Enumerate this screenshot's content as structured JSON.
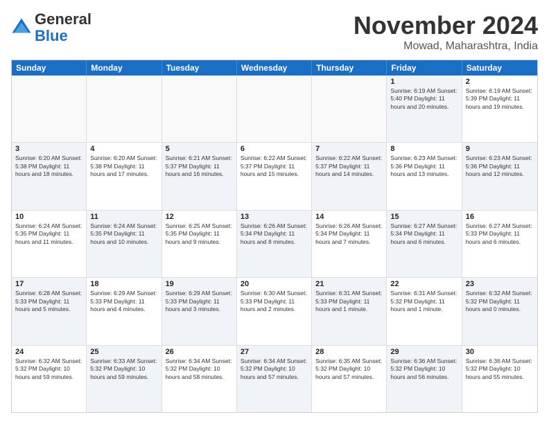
{
  "logo": {
    "line1": "General",
    "line2": "Blue"
  },
  "title": "November 2024",
  "location": "Mowad, Maharashtra, India",
  "headers": [
    "Sunday",
    "Monday",
    "Tuesday",
    "Wednesday",
    "Thursday",
    "Friday",
    "Saturday"
  ],
  "rows": [
    [
      {
        "day": "",
        "info": "",
        "empty": true
      },
      {
        "day": "",
        "info": "",
        "empty": true
      },
      {
        "day": "",
        "info": "",
        "empty": true
      },
      {
        "day": "",
        "info": "",
        "empty": true
      },
      {
        "day": "",
        "info": "",
        "empty": true
      },
      {
        "day": "1",
        "info": "Sunrise: 6:19 AM\nSunset: 5:40 PM\nDaylight: 11 hours and 20 minutes.",
        "shaded": true
      },
      {
        "day": "2",
        "info": "Sunrise: 6:19 AM\nSunset: 5:39 PM\nDaylight: 11 hours and 19 minutes.",
        "shaded": false
      }
    ],
    [
      {
        "day": "3",
        "info": "Sunrise: 6:20 AM\nSunset: 5:38 PM\nDaylight: 11 hours and 18 minutes.",
        "shaded": true
      },
      {
        "day": "4",
        "info": "Sunrise: 6:20 AM\nSunset: 5:38 PM\nDaylight: 11 hours and 17 minutes.",
        "shaded": false
      },
      {
        "day": "5",
        "info": "Sunrise: 6:21 AM\nSunset: 5:37 PM\nDaylight: 11 hours and 16 minutes.",
        "shaded": true
      },
      {
        "day": "6",
        "info": "Sunrise: 6:22 AM\nSunset: 5:37 PM\nDaylight: 11 hours and 15 minutes.",
        "shaded": false
      },
      {
        "day": "7",
        "info": "Sunrise: 6:22 AM\nSunset: 5:37 PM\nDaylight: 11 hours and 14 minutes.",
        "shaded": true
      },
      {
        "day": "8",
        "info": "Sunrise: 6:23 AM\nSunset: 5:36 PM\nDaylight: 11 hours and 13 minutes.",
        "shaded": false
      },
      {
        "day": "9",
        "info": "Sunrise: 6:23 AM\nSunset: 5:36 PM\nDaylight: 11 hours and 12 minutes.",
        "shaded": true
      }
    ],
    [
      {
        "day": "10",
        "info": "Sunrise: 6:24 AM\nSunset: 5:35 PM\nDaylight: 11 hours and 11 minutes.",
        "shaded": false
      },
      {
        "day": "11",
        "info": "Sunrise: 6:24 AM\nSunset: 5:35 PM\nDaylight: 11 hours and 10 minutes.",
        "shaded": true
      },
      {
        "day": "12",
        "info": "Sunrise: 6:25 AM\nSunset: 5:35 PM\nDaylight: 11 hours and 9 minutes.",
        "shaded": false
      },
      {
        "day": "13",
        "info": "Sunrise: 6:26 AM\nSunset: 5:34 PM\nDaylight: 11 hours and 8 minutes.",
        "shaded": true
      },
      {
        "day": "14",
        "info": "Sunrise: 6:26 AM\nSunset: 5:34 PM\nDaylight: 11 hours and 7 minutes.",
        "shaded": false
      },
      {
        "day": "15",
        "info": "Sunrise: 6:27 AM\nSunset: 5:34 PM\nDaylight: 11 hours and 6 minutes.",
        "shaded": true
      },
      {
        "day": "16",
        "info": "Sunrise: 6:27 AM\nSunset: 5:33 PM\nDaylight: 11 hours and 6 minutes.",
        "shaded": false
      }
    ],
    [
      {
        "day": "17",
        "info": "Sunrise: 6:28 AM\nSunset: 5:33 PM\nDaylight: 11 hours and 5 minutes.",
        "shaded": true
      },
      {
        "day": "18",
        "info": "Sunrise: 6:29 AM\nSunset: 5:33 PM\nDaylight: 11 hours and 4 minutes.",
        "shaded": false
      },
      {
        "day": "19",
        "info": "Sunrise: 6:29 AM\nSunset: 5:33 PM\nDaylight: 11 hours and 3 minutes.",
        "shaded": true
      },
      {
        "day": "20",
        "info": "Sunrise: 6:30 AM\nSunset: 5:33 PM\nDaylight: 11 hours and 2 minutes.",
        "shaded": false
      },
      {
        "day": "21",
        "info": "Sunrise: 6:31 AM\nSunset: 5:33 PM\nDaylight: 11 hours and 1 minute.",
        "shaded": true
      },
      {
        "day": "22",
        "info": "Sunrise: 6:31 AM\nSunset: 5:32 PM\nDaylight: 11 hours and 1 minute.",
        "shaded": false
      },
      {
        "day": "23",
        "info": "Sunrise: 6:32 AM\nSunset: 5:32 PM\nDaylight: 11 hours and 0 minutes.",
        "shaded": true
      }
    ],
    [
      {
        "day": "24",
        "info": "Sunrise: 6:32 AM\nSunset: 5:32 PM\nDaylight: 10 hours and 59 minutes.",
        "shaded": false
      },
      {
        "day": "25",
        "info": "Sunrise: 6:33 AM\nSunset: 5:32 PM\nDaylight: 10 hours and 59 minutes.",
        "shaded": true
      },
      {
        "day": "26",
        "info": "Sunrise: 6:34 AM\nSunset: 5:32 PM\nDaylight: 10 hours and 58 minutes.",
        "shaded": false
      },
      {
        "day": "27",
        "info": "Sunrise: 6:34 AM\nSunset: 5:32 PM\nDaylight: 10 hours and 57 minutes.",
        "shaded": true
      },
      {
        "day": "28",
        "info": "Sunrise: 6:35 AM\nSunset: 5:32 PM\nDaylight: 10 hours and 57 minutes.",
        "shaded": false
      },
      {
        "day": "29",
        "info": "Sunrise: 6:36 AM\nSunset: 5:32 PM\nDaylight: 10 hours and 56 minutes.",
        "shaded": true
      },
      {
        "day": "30",
        "info": "Sunrise: 6:36 AM\nSunset: 5:32 PM\nDaylight: 10 hours and 55 minutes.",
        "shaded": false
      }
    ]
  ]
}
